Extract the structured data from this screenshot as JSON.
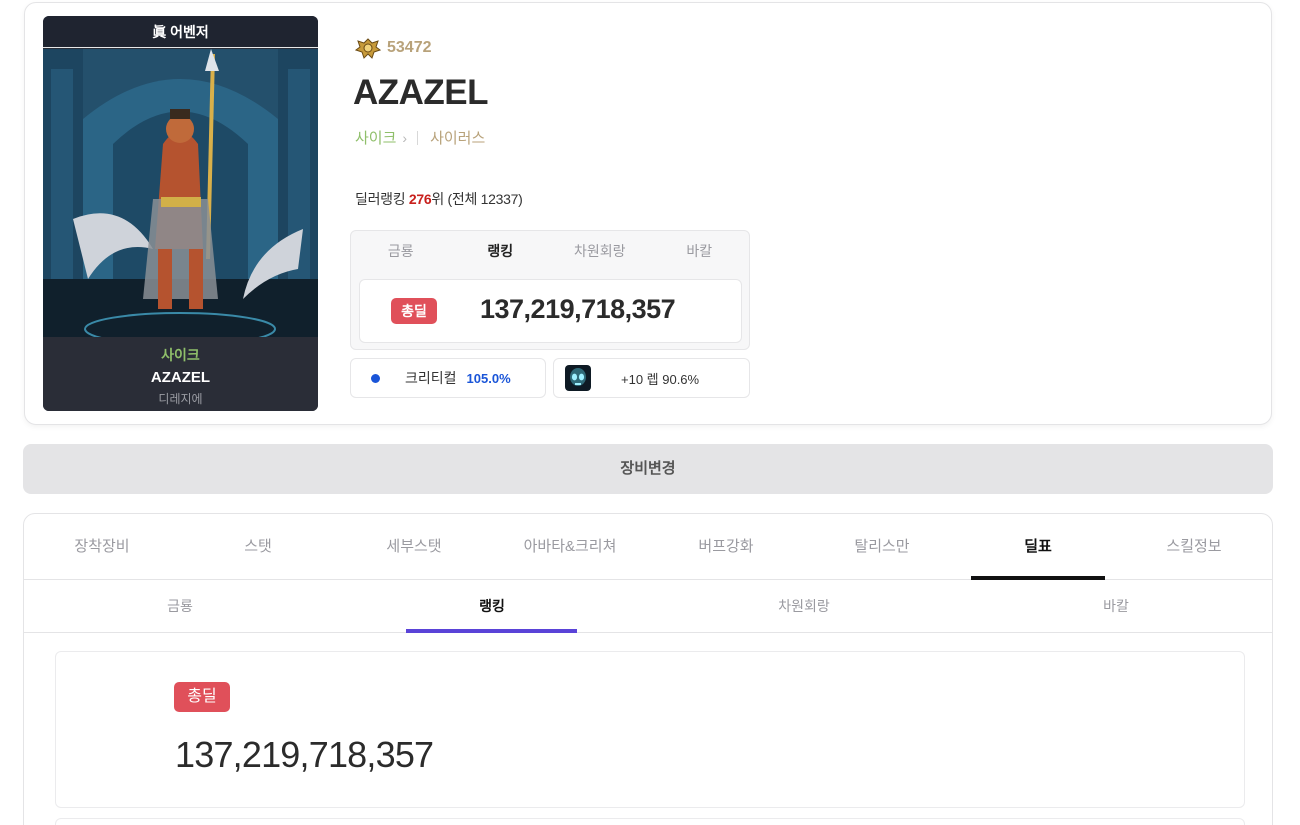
{
  "character": {
    "title": "眞 어벤저",
    "job": "사이크",
    "name": "AZAZEL",
    "server": "디레지에"
  },
  "fame": {
    "value": "53472",
    "icon": "fame-crest-icon"
  },
  "profile": {
    "name": "AZAZEL",
    "job": "사이크",
    "advancement": "사이러스",
    "rank_prefix": "딜러랭킹 ",
    "rank_value": "276",
    "rank_suffix": "위 (전체 12337)"
  },
  "damage_box": {
    "tabs": [
      "금룡",
      "랭킹",
      "차원회랑",
      "바칼"
    ],
    "active_tab": 1,
    "badge": "총딜",
    "value": "137,219,718,357"
  },
  "stats": {
    "critical_label": "크리티컬",
    "critical_value": "105.0%",
    "talisman_text": "+10 렙 90.6%"
  },
  "equip_button": "장비변경",
  "main_tabs": [
    "장착장비",
    "스탯",
    "세부스탯",
    "아바타&크리쳐",
    "버프강화",
    "탈리스만",
    "딜표",
    "스킬정보"
  ],
  "main_active": 6,
  "sub_tabs": [
    "금룡",
    "랭킹",
    "차원회랑",
    "바칼"
  ],
  "sub_active": 1,
  "total": {
    "badge": "총딜",
    "value": "137,219,718,357"
  },
  "colors": {
    "accent_red": "#e0505a",
    "accent_purple": "#5a43d8",
    "crit_blue": "#1a55d8",
    "job_green": "#8fbf6a",
    "fame_gold": "#b8a27a"
  }
}
